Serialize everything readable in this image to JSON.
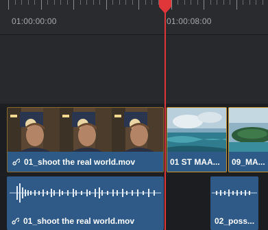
{
  "ruler": {
    "start_timecode": "01:00:00:00",
    "mid_timecode": "01:00:08:00"
  },
  "video_track": {
    "clips": [
      {
        "label": "01_shoot the real world.mov",
        "linked": true,
        "selected": false
      },
      {
        "label": "01 ST MAA...",
        "linked": false,
        "selected": true
      },
      {
        "label": "09_MA...",
        "linked": false,
        "selected": true
      }
    ]
  },
  "audio_track": {
    "clips": [
      {
        "label": "01_shoot the real world.mov",
        "linked": true
      },
      {
        "label": "02_poss...",
        "linked": false
      }
    ]
  },
  "colors": {
    "playhead": "#e0363a",
    "clip_blue": "#2d5a86",
    "clip_selected_border": "#c9952f",
    "track_background": "#28292c",
    "ruler_background": "#2a2b2f"
  }
}
